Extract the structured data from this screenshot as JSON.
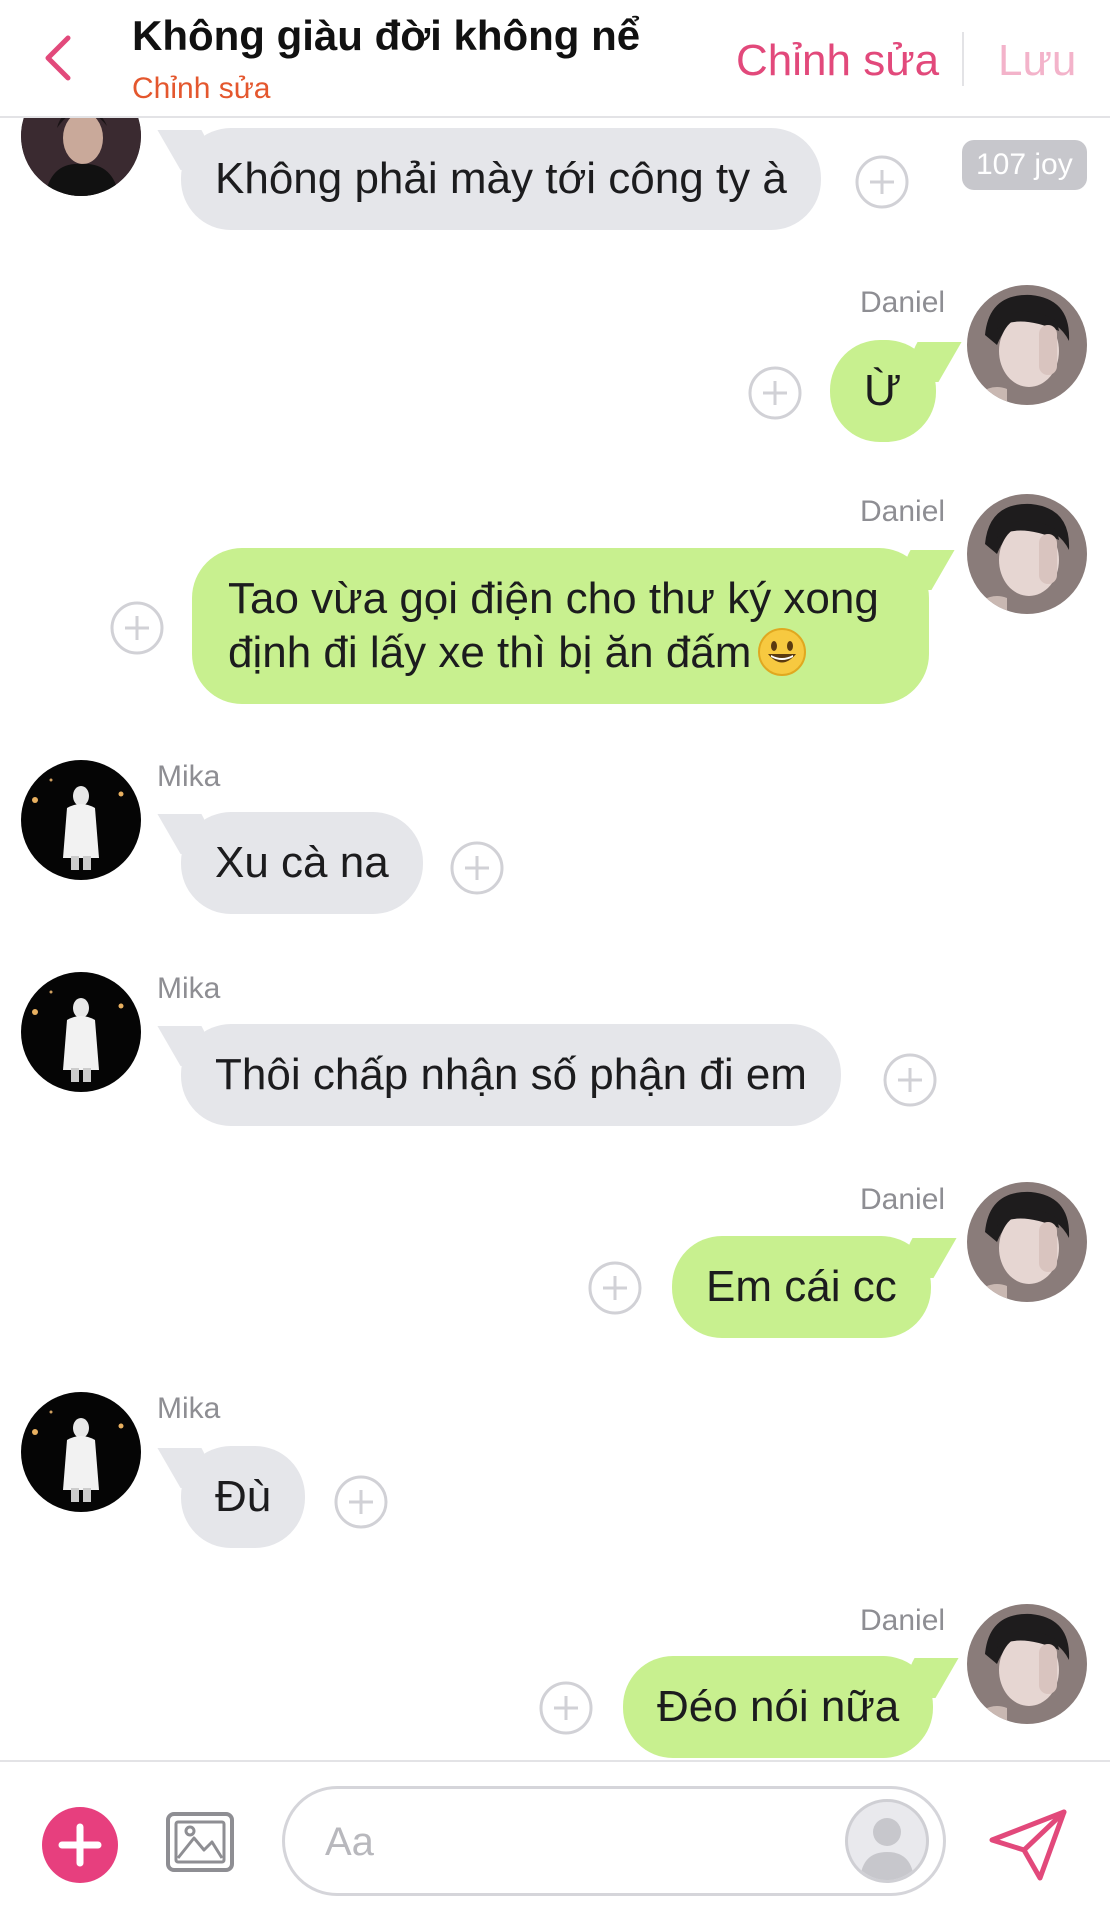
{
  "header": {
    "title": "Không giàu đời không nể",
    "subtitle": "Chỉnh sửa",
    "edit_label": "Chỉnh sửa",
    "save_label": "Lưu",
    "accent_color": "#e2497b"
  },
  "joy_badge": "107 joy",
  "messages": [
    {
      "sender": "",
      "side": "incoming",
      "text": "Không phải mày tới công ty à"
    },
    {
      "sender": "Daniel",
      "side": "outgoing",
      "text": "Ừ"
    },
    {
      "sender": "Daniel",
      "side": "outgoing",
      "lines": [
        "Tao vừa gọi điện cho thư ký xong",
        "định đi lấy xe thì bị ăn đấm"
      ],
      "emoji": "grinning-face"
    },
    {
      "sender": "Mika",
      "side": "incoming",
      "text": "Xu cà na"
    },
    {
      "sender": "Mika",
      "side": "incoming",
      "text": "Thôi chấp nhận số phận đi em"
    },
    {
      "sender": "Daniel",
      "side": "outgoing",
      "text": "Em cái cc"
    },
    {
      "sender": "Mika",
      "side": "incoming",
      "text": "Đù"
    },
    {
      "sender": "Daniel",
      "side": "outgoing",
      "text": "Đéo nói nữa"
    }
  ],
  "composer": {
    "placeholder": "Aa",
    "value": ""
  },
  "colors": {
    "incoming_bubble": "#e5e6ea",
    "outgoing_bubble": "#c8f08f",
    "plus_button": "#e73f7e"
  },
  "icons": [
    "back-chevron-icon",
    "add-reaction-icon",
    "plus-icon",
    "image-icon",
    "sticker-avatar-icon",
    "send-icon",
    "grinning-face-emoji"
  ]
}
